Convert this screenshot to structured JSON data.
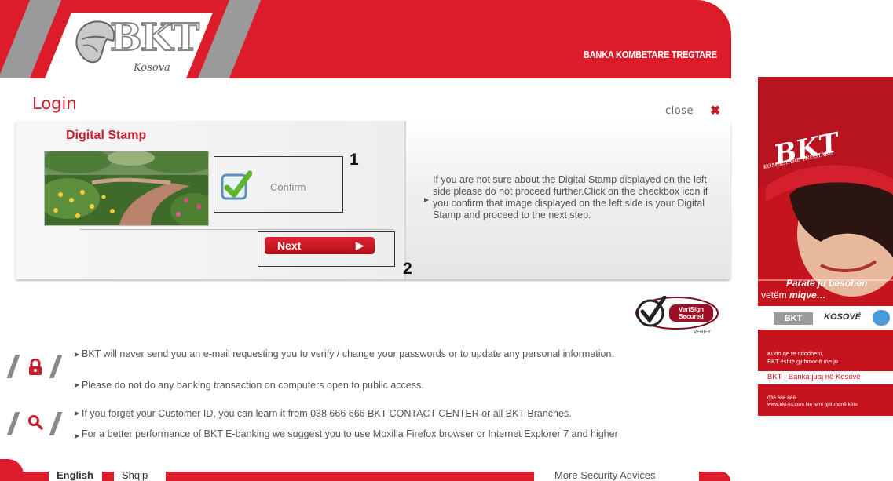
{
  "header": {
    "logo_text": "BKT",
    "logo_sub": "Kosova",
    "bank_name": "BANKA KOMBETARE TREGTARE"
  },
  "login": {
    "title": "Login",
    "close_label": "close",
    "stamp_title": "Digital Stamp",
    "confirm_label": "Confirm",
    "next_label": "Next",
    "annotation_1": "1",
    "annotation_2": "2",
    "info": "If you are not sure about the Digital Stamp displayed on the left side please do not proceed further.Click on the checkbox icon if you confirm that image displayed on the left side is your Digital Stamp and proceed to the next step."
  },
  "verisign": {
    "line1": "VeriSign",
    "line2": "Secured",
    "line3": "VERIFY"
  },
  "security": {
    "notes_a": [
      "BKT will never send you an e-mail requesting you to verify / change your passwords or to update any personal information.",
      "Please do not do any banking transaction on computers open to public access."
    ],
    "notes_b": [
      "If you forget your Customer ID, you can learn it from 038 666 666 BKT CONTACT CENTER or all BKT Branches.",
      "For a better performance of BKT E-banking we suggest you to use Moxilla Firefox browser or Internet Explorer 7 and higher"
    ]
  },
  "footer": {
    "english": "English",
    "shqip": "Shqip",
    "more_security": "More Security Advices"
  },
  "ad": {
    "logo": "BKT",
    "logo_tagline": "KOMBETARE TREGTARE",
    "slogan_1": "Paratë ju besohen",
    "slogan_2_prefix": "vetëm ",
    "slogan_2_em": "miqve…",
    "strip_logo": "BKT",
    "strip_country": "KOSOVË",
    "text_1": "Kudo që të ndodheni,",
    "text_2": "BKT është gjithmonë me ju",
    "text_3": "BKT - Banka juaj në Kosovë",
    "phone": "038 666 666",
    "site": "www.bkt-ks.com   Ne jemi gjithmonë këtu"
  },
  "colors": {
    "brand_red": "#dd1c2b",
    "title_red": "#c81e2c",
    "stripe_gray": "#9a9a9a"
  }
}
